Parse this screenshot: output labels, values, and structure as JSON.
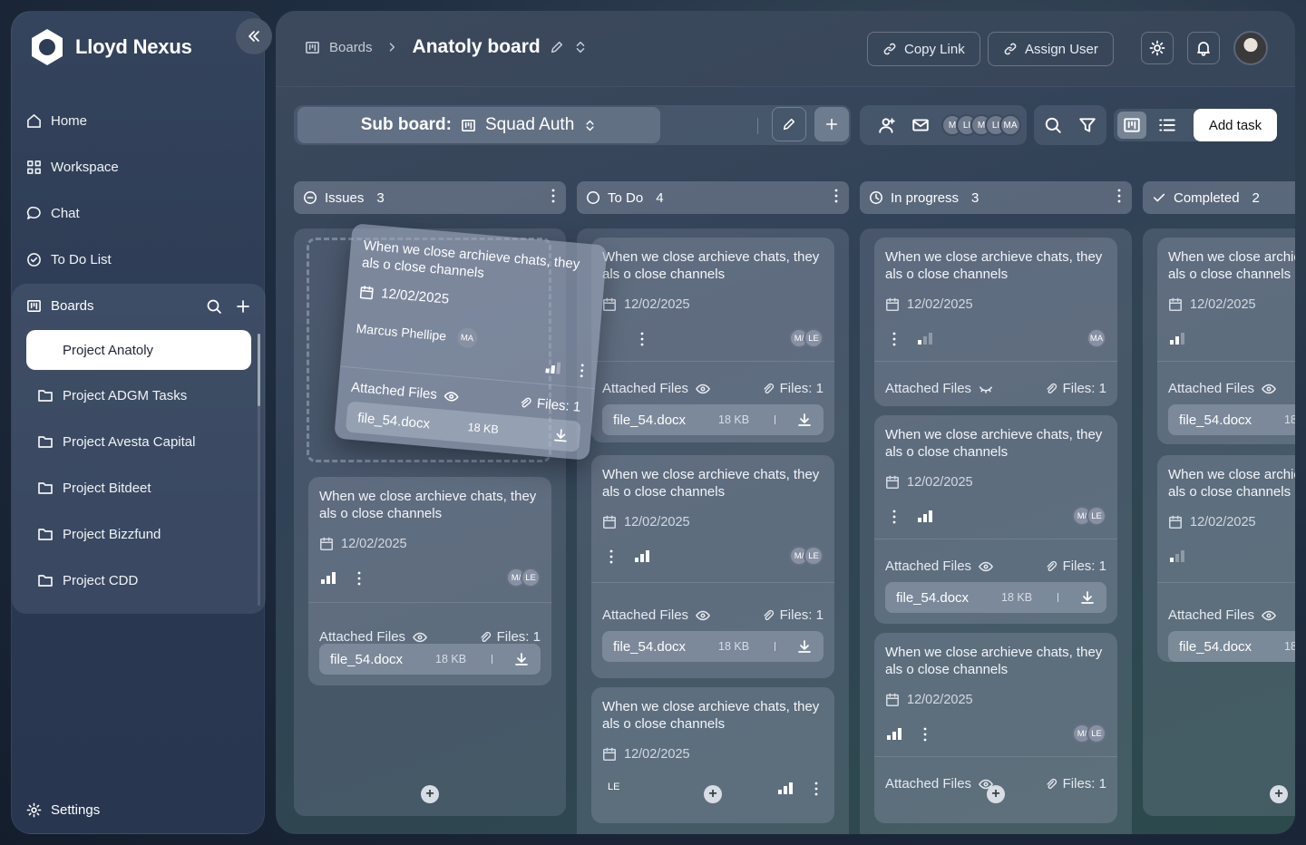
{
  "brand": {
    "name": "Lloyd Nexus"
  },
  "nav": {
    "home": "Home",
    "workspace": "Workspace",
    "chat": "Chat",
    "todo": "To Do List",
    "boards": "Boards",
    "settings": "Settings"
  },
  "projects": [
    "Project Anatoly",
    "Project ADGM Tasks",
    "Project Avesta Capital",
    "Project Bitdeet",
    "Project Bizzfund",
    "Project CDD"
  ],
  "header": {
    "crumb": "Boards",
    "title": "Anatoly board",
    "copy_link": "Copy Link",
    "assign_user": "Assign User"
  },
  "toolbar": {
    "sub_label": "Sub board:",
    "sub_name": "Squad Auth",
    "add_task": "Add task",
    "members": [
      "M",
      "LI",
      "M",
      "LI",
      "MA"
    ]
  },
  "columns": [
    {
      "name": "Issues",
      "count": "3"
    },
    {
      "name": "To Do",
      "count": "4"
    },
    {
      "name": "In progress",
      "count": "3"
    },
    {
      "name": "Completed",
      "count": "2"
    }
  ],
  "card": {
    "title": "When we close archieve chats, they als o close channels",
    "title_wrapped_a": "When we close archieve chats, they",
    "title_wrapped_b": "als o close channels",
    "date": "12/02/2025",
    "attached": "Attached Files",
    "files": "Files: 1",
    "file_name": "file_54.docx",
    "file_size": "18 KB",
    "owner": "Marcus Phellipe",
    "av_ma": "MA",
    "av_mi": "M/",
    "av_le": "LE"
  },
  "colors": {
    "accent": "#ffffff",
    "panel": "#34445c"
  }
}
